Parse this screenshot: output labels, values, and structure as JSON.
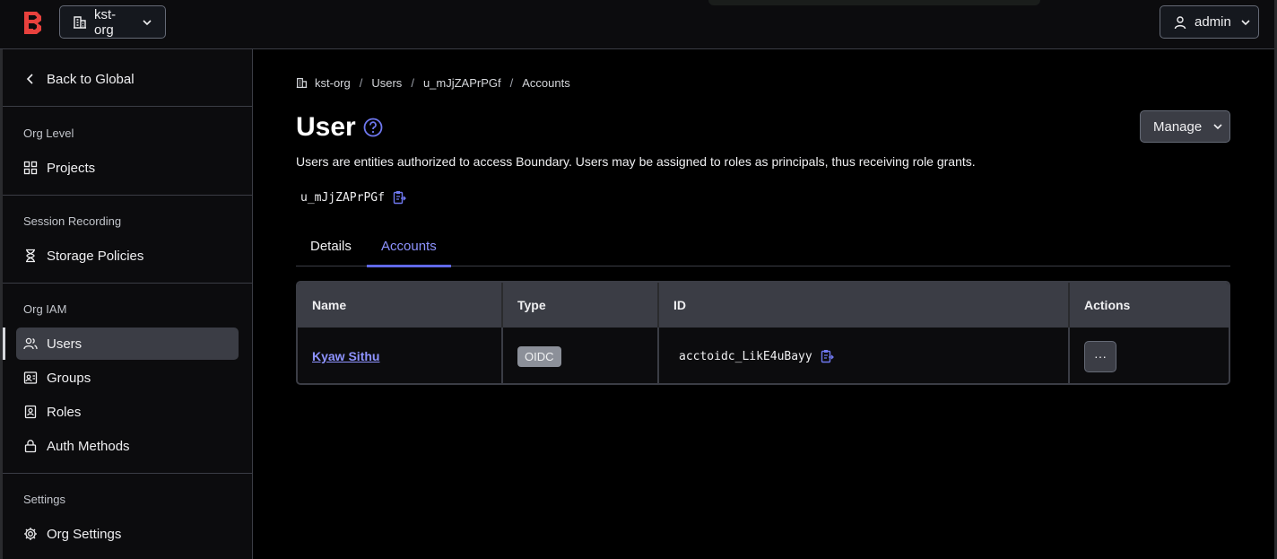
{
  "header": {
    "org_name": "kst-org",
    "user_name": "admin"
  },
  "sidebar": {
    "back_label": "Back to Global",
    "sections": [
      {
        "heading": "Org Level",
        "items": [
          "Projects"
        ]
      },
      {
        "heading": "Session Recording",
        "items": [
          "Storage Policies"
        ]
      },
      {
        "heading": "Org IAM",
        "items": [
          "Users",
          "Groups",
          "Roles",
          "Auth Methods"
        ]
      },
      {
        "heading": "Settings",
        "items": [
          "Org Settings"
        ]
      }
    ],
    "active_item": "Users"
  },
  "breadcrumb": [
    "kst-org",
    "Users",
    "u_mJjZAPrPGf",
    "Accounts"
  ],
  "page": {
    "title": "User",
    "description": "Users are entities authorized to access Boundary. Users may be assigned to roles as principals, thus receiving role grants.",
    "user_id": "u_mJjZAPrPGf",
    "manage_label": "Manage"
  },
  "tabs": [
    {
      "label": "Details",
      "active": false
    },
    {
      "label": "Accounts",
      "active": true
    }
  ],
  "table": {
    "columns": [
      "Name",
      "Type",
      "ID",
      "Actions"
    ],
    "rows": [
      {
        "name": "Kyaw Sithu",
        "type": "OIDC",
        "id": "acctoidc_LikE4uBayy",
        "actions": "···"
      }
    ]
  },
  "colors": {
    "accent": "#6068e8",
    "link": "#8e93ff",
    "logo": "#e8413d"
  }
}
